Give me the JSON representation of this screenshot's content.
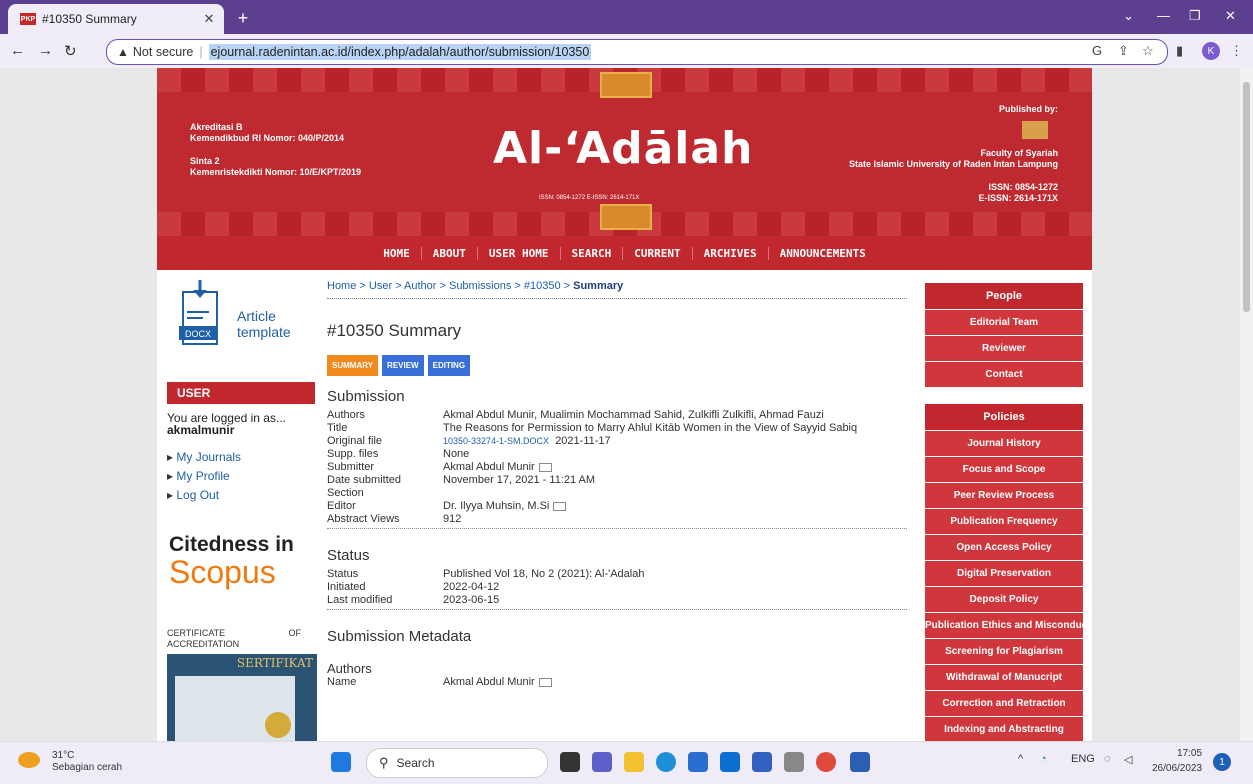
{
  "browser": {
    "tab_title": "#10350 Summary",
    "favicon_label": "PKP",
    "address_security": "Not secure",
    "url": "ejournal.radenintan.ac.id/index.php/adalah/author/submission/10350",
    "profile_initial": "K"
  },
  "banner": {
    "accred_line1": "Akreditasi B",
    "accred_line2": "Kemendikbud RI Nomor: 040/P/2014",
    "sinta_line1": "Sinta 2",
    "sinta_line2": "Kemenristekdikti Nomor: 10/E/KPT/2019",
    "logo": "Al-‘Adālah",
    "issn_small": "ISSN: 0854-1272      E-ISSN: 2614-171X",
    "published_by": "Published by:",
    "faculty": "Faculty of Syariah",
    "university": "State Islamic University of Raden Intan Lampung",
    "issn": "ISSN: 0854-1272",
    "eissn": "E-ISSN: 2614-171X"
  },
  "nav": {
    "items": [
      "HOME",
      "ABOUT",
      "USER HOME",
      "SEARCH",
      "CURRENT",
      "ARCHIVES",
      "ANNOUNCEMENTS"
    ]
  },
  "left": {
    "template_line1": "Article",
    "template_line2": "template",
    "docx_label": "DOCX",
    "user_header": "USER",
    "logged_in_as": "You are logged in as...",
    "username": "akmalmunir",
    "links": [
      "My Journals",
      "My Profile",
      "Log Out"
    ],
    "cited_line1": "Citedness in",
    "cited_line2": "Scopus",
    "cert_label": "CERTIFICATE OF ACCREDITATION",
    "cert_title": "SERTIFIKAT"
  },
  "main": {
    "breadcrumb": "Home > User > Author > Submissions > #10350 > ",
    "breadcrumb_current": "Summary",
    "title": "#10350 Summary",
    "tabs": [
      "SUMMARY",
      "REVIEW",
      "EDITING"
    ],
    "submission_heading": "Submission",
    "submission": [
      {
        "k": "Authors",
        "v": "Akmal Abdul Munir, Mualimin Mochammad Sahid, Zulkifli Zulkifli, Ahmad Fauzi"
      },
      {
        "k": "Title",
        "v": "The Reasons for Permission to Marry Ahlul Kitāb Women in the View of Sayyid Sabiq"
      },
      {
        "k": "Original file",
        "link": "10350-33274-1-SM.DOCX",
        "v": "2021-11-17"
      },
      {
        "k": "Supp. files",
        "v": "None"
      },
      {
        "k": "Submitter",
        "v": "Akmal Abdul Munir"
      },
      {
        "k": "Date submitted",
        "v": "November 17, 2021 - 11:21 AM"
      },
      {
        "k": "Section",
        "v": ""
      },
      {
        "k": "Editor",
        "v": "Dr. Ilyya Muhsin, M.Si"
      },
      {
        "k": "Abstract Views",
        "v": "912"
      }
    ],
    "status_heading": "Status",
    "status": [
      {
        "k": "Status",
        "v": "Published    Vol 18, No 2 (2021): Al-'Adalah"
      },
      {
        "k": "Initiated",
        "v": "2022-04-12"
      },
      {
        "k": "Last modified",
        "v": "2023-06-15"
      }
    ],
    "metadata_heading": "Submission Metadata",
    "authors_heading": "Authors",
    "name_label": "Name",
    "name_value": "Akmal Abdul Munir"
  },
  "right": {
    "people_header": "People",
    "people": [
      "Editorial Team",
      "Reviewer",
      "Contact"
    ],
    "policies_header": "Policies",
    "policies": [
      "Journal History",
      "Focus and Scope",
      "Peer Review Process",
      "Publication Frequency",
      "Open Access Policy",
      "Digital Preservation",
      "Deposit Policy",
      "Publication Ethics and Misconduct",
      "Screening for Plagiarism",
      "Withdrawal of Manucript",
      "Correction and Retraction",
      "Indexing and Abstracting"
    ]
  },
  "taskbar": {
    "temp": "31°C",
    "weather": "Sebagian cerah",
    "search_placeholder": "Search",
    "lang": "ENG",
    "time": "17:05",
    "date": "26/06/2023",
    "notif_count": "1"
  },
  "colors": {
    "brand_red": "#c0282e",
    "link_blue": "#1f5fa8",
    "tab_orange": "#f08a1c",
    "tab_blue": "#3b6fd8"
  }
}
